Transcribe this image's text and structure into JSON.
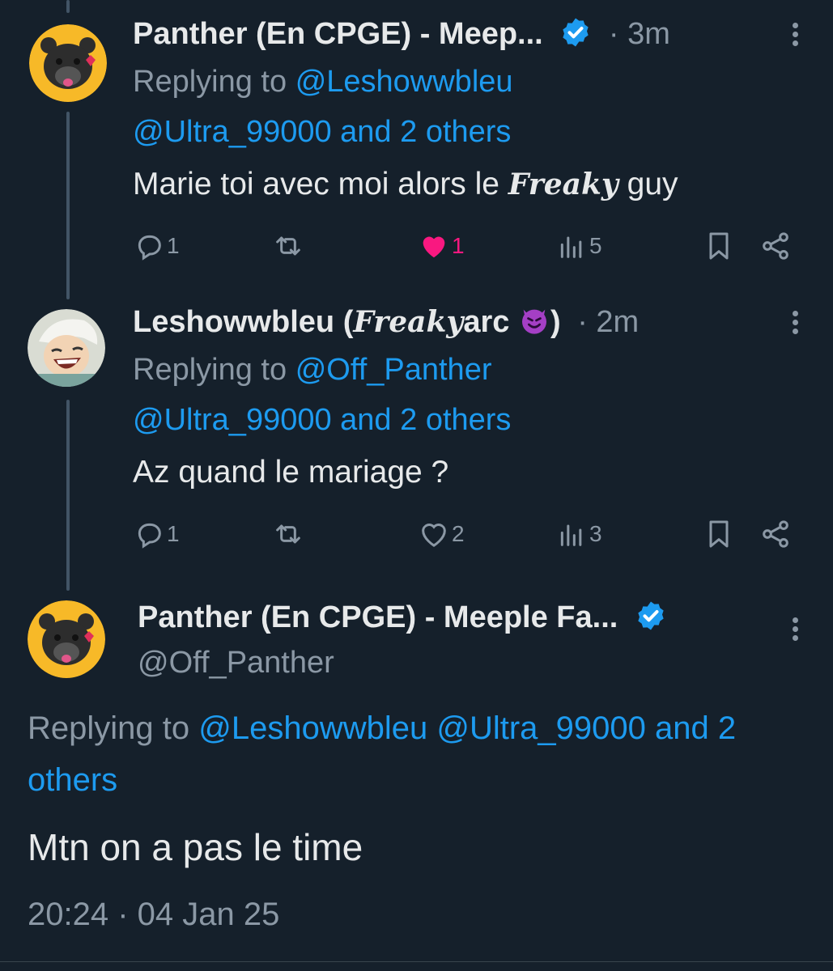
{
  "tweets": [
    {
      "name": "Panther (En CPGE) - Meep...",
      "time": "3m",
      "replying_prefix": "Replying to",
      "replying_line1": "@Leshowwbleu",
      "replying_line2": "@Ultra_99000 and 2 others",
      "text_before": "Marie toi avec moi alors le ",
      "text_fancy": "Freaky",
      "text_after": " guy",
      "replies": "1",
      "likes": "1",
      "views": "5"
    },
    {
      "name_prefix": "Leshowwbleu (",
      "name_fancy": "Freaky",
      "name_mid": "arc ",
      "name_suffix": ")",
      "time": "2m",
      "replying_prefix": "Replying to",
      "replying_line1": "@Off_Panther",
      "replying_line2": "@Ultra_99000 and 2 others",
      "text": "Az quand le mariage ?",
      "replies": "1",
      "likes": "2",
      "views": "3"
    }
  ],
  "main": {
    "name": "Panther (En CPGE) - Meeple Fa...",
    "handle": "@Off_Panther",
    "replying_prefix": "Replying to",
    "replying_mentions": "@Leshowwbleu @Ultra_99000 and 2",
    "replying_line2": "others",
    "text": "Mtn on a pas le time",
    "timestamp": "20:24 · 04 Jan 25"
  },
  "colors": {
    "background": "#15202b",
    "link": "#1d9bf0",
    "muted": "#8b98a5",
    "like": "#f91880",
    "verified": "#1d9bf0"
  },
  "icons": [
    "verified-badge-icon",
    "more-icon",
    "reply-icon",
    "retweet-icon",
    "heart-icon",
    "views-icon",
    "bookmark-icon",
    "share-icon",
    "devil-emoji-icon"
  ]
}
